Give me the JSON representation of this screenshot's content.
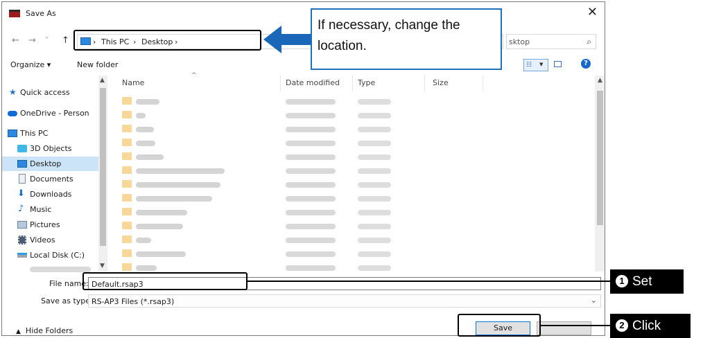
{
  "dialog": {
    "title": "Save As",
    "close_icon": "close-icon"
  },
  "nav": {
    "back_icon": "←",
    "forward_icon": "→",
    "recent_icon": "˅",
    "up_icon": "↑",
    "sep": "›",
    "breadcrumb": [
      "This PC",
      "Desktop"
    ],
    "search_text": "sktop",
    "search_icon": "⌕"
  },
  "toolbar": {
    "organize": "Organize ▾",
    "new_folder": "New folder",
    "help": "?"
  },
  "sidebar": {
    "items": [
      {
        "label": "Quick access"
      },
      {
        "label": "OneDrive - Person"
      },
      {
        "label": "This PC"
      },
      {
        "label": "3D Objects"
      },
      {
        "label": "Desktop"
      },
      {
        "label": "Documents"
      },
      {
        "label": "Downloads"
      },
      {
        "label": "Music"
      },
      {
        "label": "Pictures"
      },
      {
        "label": "Videos"
      },
      {
        "label": "Local Disk (C:)"
      }
    ]
  },
  "files": {
    "columns": [
      "Name",
      "Date modified",
      "Type",
      "Size"
    ]
  },
  "form": {
    "filename_label": "File name:",
    "filename_value": "Default.rsap3",
    "type_label": "Save as type:",
    "type_value": "RS-AP3 Files (*.rsap3)"
  },
  "footer": {
    "hide_folders": "Hide Folders",
    "save": "Save"
  },
  "annotations": {
    "callout": "If necessary, change the location.",
    "step1_num": "1",
    "step1": "Set",
    "step2_num": "2",
    "step2": "Click"
  },
  "colors": {
    "accent": "#0078d7",
    "callout_border": "#1f6fbf",
    "arrow": "#1a66b8",
    "selection": "#cce4f7"
  }
}
